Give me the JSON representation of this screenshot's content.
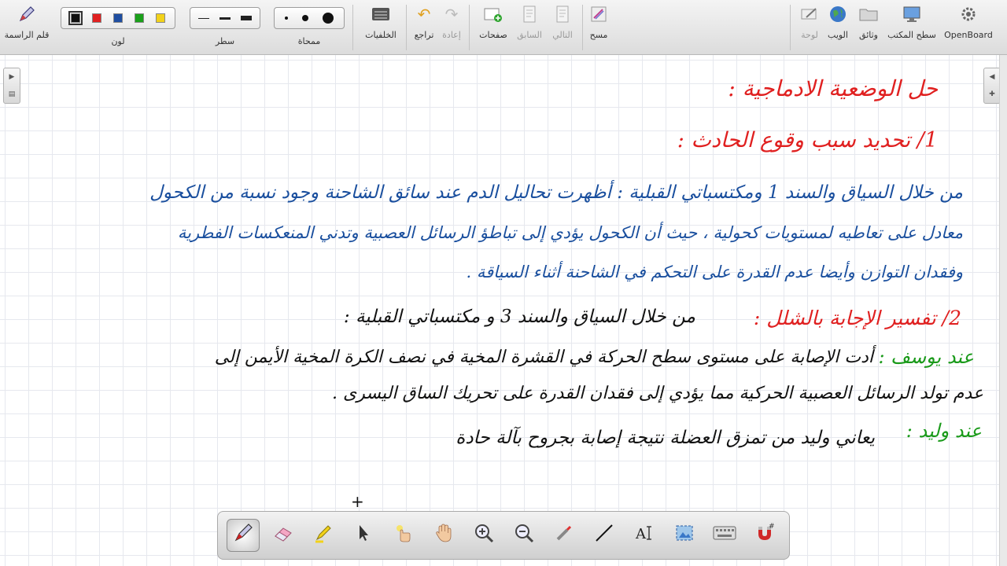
{
  "toolbar": {
    "pen_label": "قلم الراسمة",
    "color_label": "لون",
    "line_label": "سطر",
    "eraser_label": "ممحاة",
    "backgrounds_label": "الخلفيات",
    "undo_label": "تراجع",
    "redo_label": "إعادة",
    "pages_label": "صفحات",
    "previous_label": "السابق",
    "next_label": "التالي",
    "clear_label": "مسح",
    "board_label": "لوحة",
    "web_label": "الويب",
    "documents_label": "وثائق",
    "desktop_label": "سطح المكتب",
    "openboard_label": "OpenBoard",
    "colors": [
      "#111111",
      "#e02020",
      "#1f4ea1",
      "#1aa01a",
      "#f2d21a"
    ]
  },
  "board": {
    "lines": [
      "حل الوضعية الادماجية :",
      "1/ تحديد سبب وقوع الحادث :",
      "من خلال السياق والسند 1 ومكتسباتي القبلية : أظهرت تحاليل الدم عند سائق الشاحنة وجود نسبة من الكحول",
      "معادل على تعاطيه لمستويات كحولية ، حيث أن الكحول يؤدي إلى تباطؤ الرسائل العصبية وتدني المنعكسات الفطرية",
      "وفقدان التوازن وأيضا عدم القدرة على التحكم في الشاحنة أثناء السياقة .",
      "2/ تفسير الإجابة بالشلل :",
      "من خلال السياق والسند 3 و مكتسباتي القبلية :",
      "عند يوسف :",
      "أدت الإصابة على مستوى سطح الحركة في القشرة المخية في نصف الكرة المخية الأيمن إلى",
      "عدم تولد الرسائل العصبية الحركية مما يؤدي إلى فقدان القدرة على تحريك الساق اليسرى .",
      "عند وليد :",
      "يعاني وليد من تمزق العضلة نتيجة إصابة بجروح بآلة حادة"
    ]
  },
  "icons": {
    "pen": "pen-icon",
    "eraser": "eraser-icon",
    "marker": "highlighter-icon",
    "pointer": "pointer-icon",
    "laser": "laser-pointer-icon",
    "hand": "hand-icon",
    "zoom_in": "zoom-in-icon",
    "zoom_out": "zoom-out-icon",
    "capture": "capture-icon",
    "line": "line-icon",
    "text": "text-icon",
    "select": "selection-icon",
    "keyboard": "keyboard-icon",
    "snap": "magnet-icon"
  }
}
